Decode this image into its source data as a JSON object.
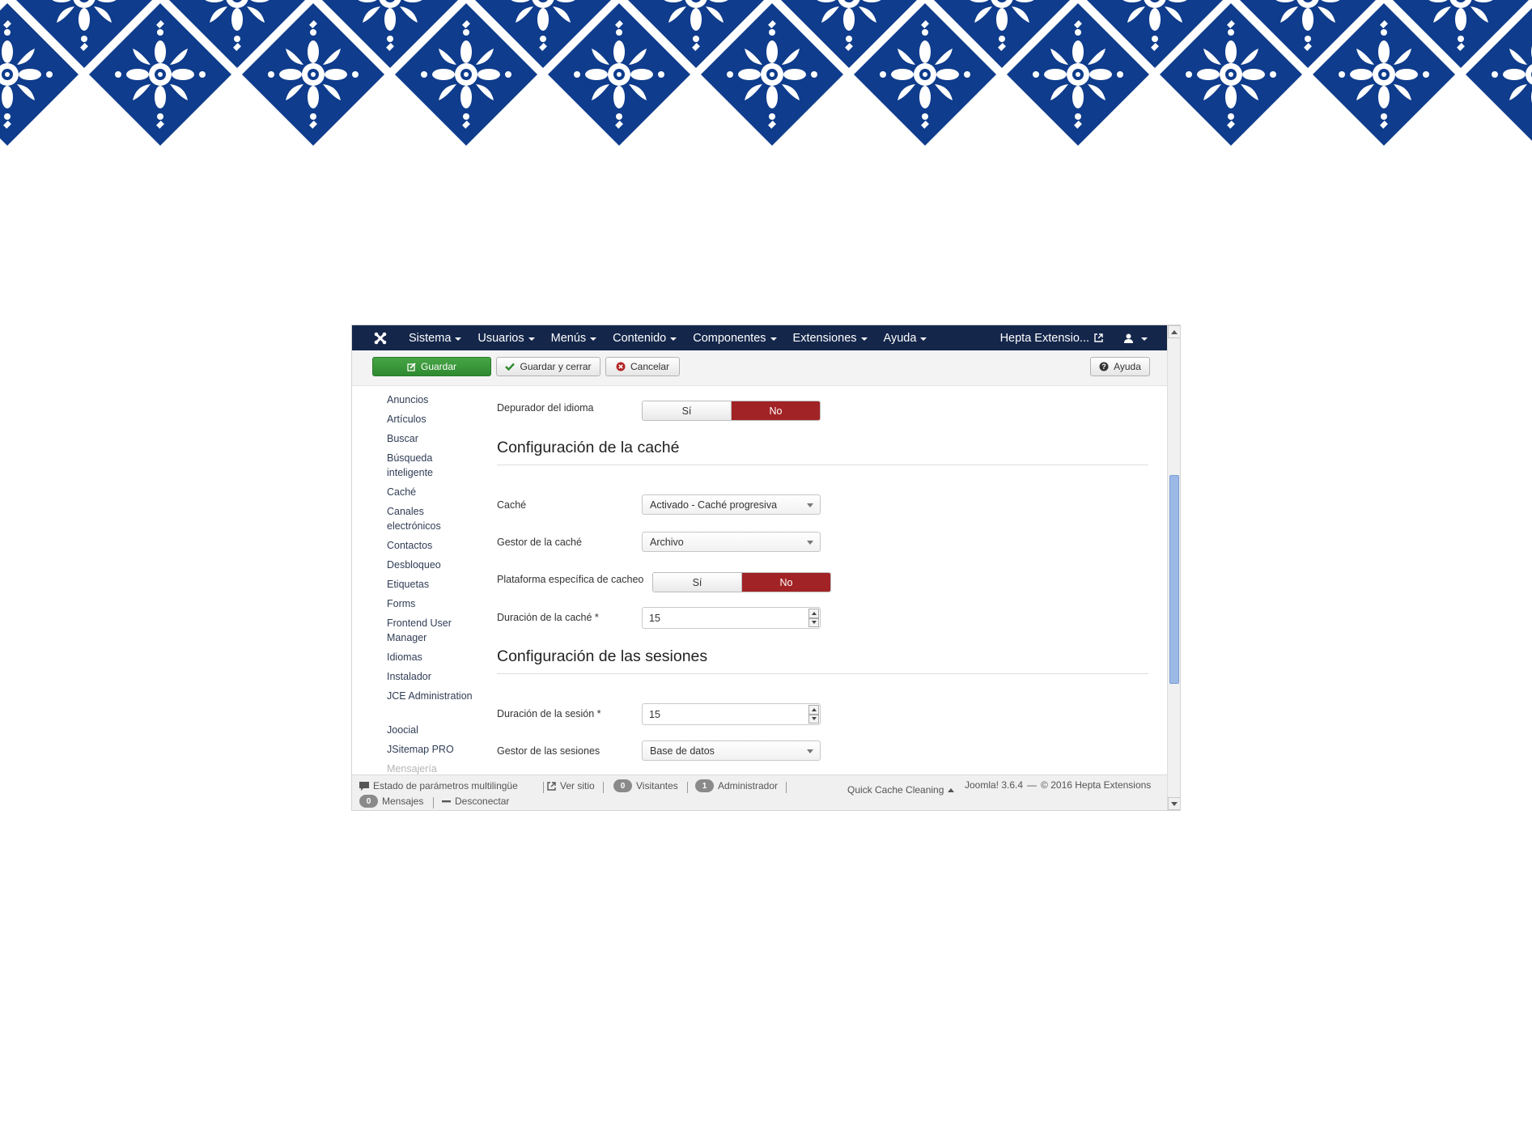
{
  "navbar": {
    "menu": [
      {
        "label": "Sistema"
      },
      {
        "label": "Usuarios"
      },
      {
        "label": "Menús"
      },
      {
        "label": "Contenido"
      },
      {
        "label": "Componentes"
      },
      {
        "label": "Extensiones"
      },
      {
        "label": "Ayuda"
      }
    ],
    "site_link": "Hepta Extensio..."
  },
  "toolbar": {
    "save": "Guardar",
    "save_close": "Guardar y cerrar",
    "cancel": "Cancelar",
    "help": "Ayuda"
  },
  "sidebar": {
    "items": [
      {
        "label": "Anuncios"
      },
      {
        "label": "Artículos"
      },
      {
        "label": "Buscar"
      },
      {
        "label": "Búsqueda inteligente"
      },
      {
        "label": "Caché"
      },
      {
        "label": "Canales electrónicos"
      },
      {
        "label": "Contactos"
      },
      {
        "label": "Desbloqueo"
      },
      {
        "label": "Etiquetas"
      },
      {
        "label": "Forms"
      },
      {
        "label": "Frontend User Manager"
      },
      {
        "label": "Idiomas"
      },
      {
        "label": "Instalador"
      },
      {
        "label": "JCE Administration"
      },
      {
        "label": "Joocial"
      },
      {
        "label": "JSitemap PRO"
      },
      {
        "label": "Mensajería"
      }
    ]
  },
  "form": {
    "language_debug": {
      "label": "Depurador del idioma",
      "yes": "Sí",
      "no": "No",
      "selected": "No"
    },
    "cache_section": {
      "title": "Configuración de la caché"
    },
    "cache": {
      "label": "Caché",
      "value": "Activado - Caché progresiva"
    },
    "cache_handler": {
      "label": "Gestor de la caché",
      "value": "Archivo"
    },
    "platform_cache": {
      "label": "Plataforma específica de cacheo",
      "yes": "Sí",
      "no": "No",
      "selected": "No"
    },
    "cache_time": {
      "label": "Duración de la caché *",
      "value": "15"
    },
    "session_section": {
      "title": "Configuración de las sesiones"
    },
    "session_time": {
      "label": "Duración de la sesión *",
      "value": "15"
    },
    "session_handler": {
      "label": "Gestor de las sesiones",
      "value": "Base de datos"
    }
  },
  "statusbar": {
    "multilang": "Estado de parámetros multilingüe",
    "view_site": "Ver sitio",
    "visitors_count": "0",
    "visitors": "Visitantes",
    "admins_count": "1",
    "admins": "Administrador",
    "messages_count": "0",
    "messages": "Mensajes",
    "logout": "Desconectar",
    "quick_cache": "Quick Cache Cleaning",
    "version": "Joomla! 3.6.4",
    "copyright": "© 2016 Hepta Extensions"
  },
  "colors": {
    "navbar": "#14264a",
    "save_button": "#46a546",
    "toggle_active": "#a22325",
    "banner_blue": "#0f3c8c",
    "scroll_thumb": "#9cb9e6"
  }
}
